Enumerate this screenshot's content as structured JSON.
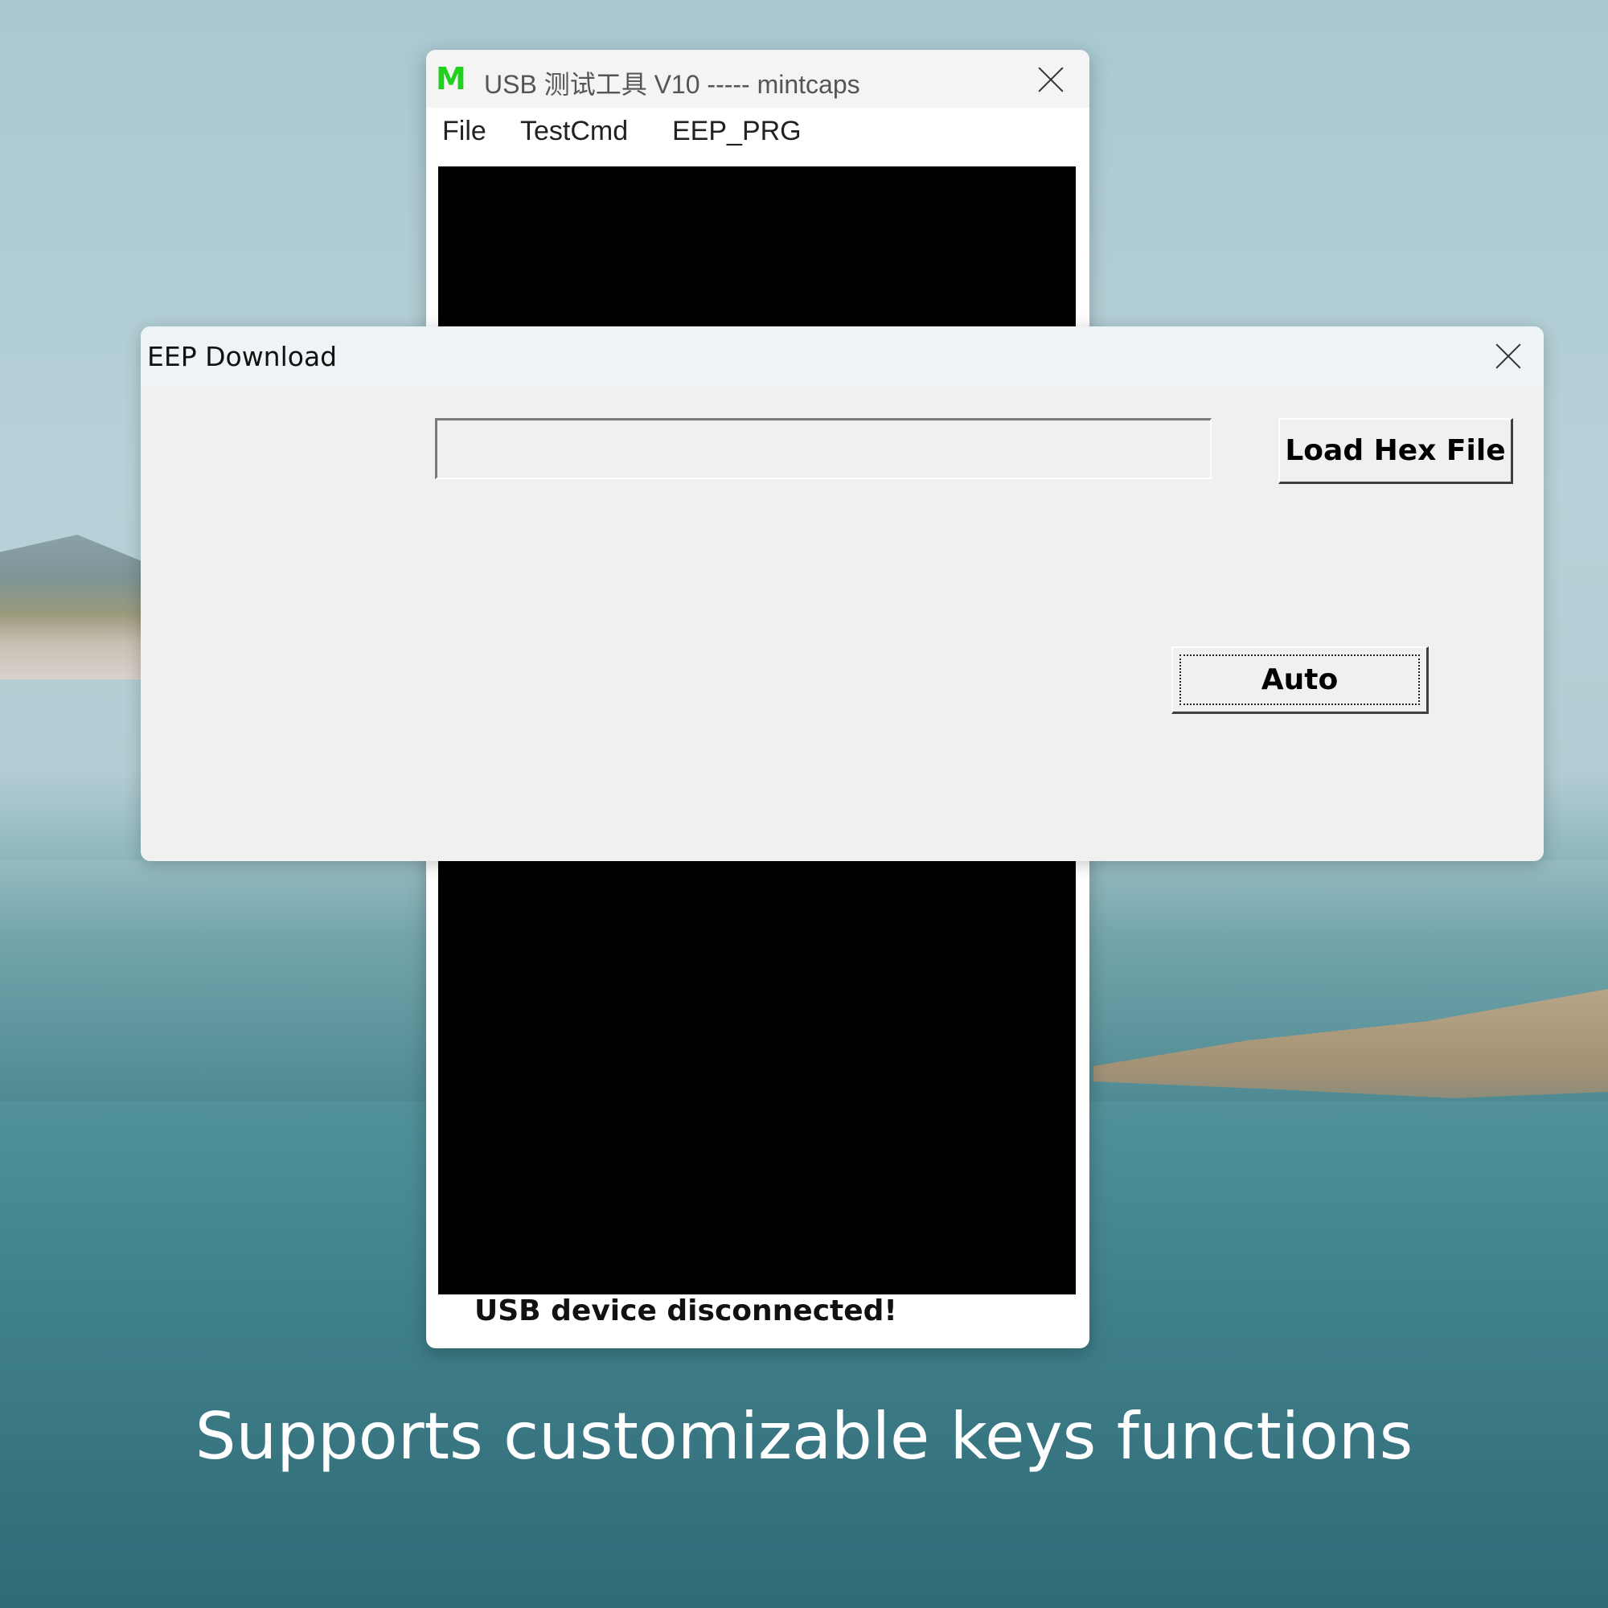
{
  "main_window": {
    "logo": "M",
    "title": "USB 测试工具 V10 ----- mintcaps",
    "menu": [
      {
        "label": "File"
      },
      {
        "label": "TestCmd"
      },
      {
        "label": "EEP_PRG"
      }
    ],
    "status": "USB device disconnected!"
  },
  "dialog": {
    "title": "EEP Download",
    "hex_path_value": "",
    "load_button_label": "Load Hex File",
    "auto_button_label": "Auto"
  },
  "caption": "Supports customizable keys functions",
  "colors": {
    "logo": "#22d11f",
    "console_background": "#000000",
    "dialog_background": "#f0f0f0"
  }
}
